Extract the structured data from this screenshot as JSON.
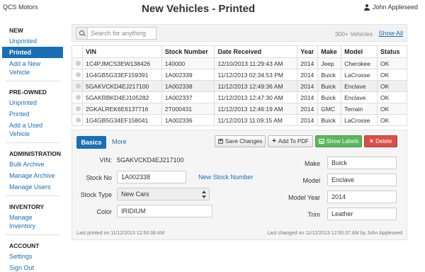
{
  "app": {
    "brand": "QCS Motors",
    "title": "New Vehicles - Printed",
    "user": "John Appleseed"
  },
  "sidebar": {
    "sections": [
      {
        "heading": "NEW",
        "items": [
          "Unprinted",
          "Printed",
          "Add a New Vehicle"
        ]
      },
      {
        "heading": "PRE-OWNED",
        "items": [
          "Unprinted",
          "Printed",
          "Add a Used Vehicle"
        ]
      },
      {
        "heading": "ADMINISTRATION",
        "items": [
          "Bulk Archive",
          "Manage Archive",
          "Manage Users"
        ]
      },
      {
        "heading": "INVENTORY",
        "items": [
          "Manage Inventory"
        ]
      },
      {
        "heading": "ACCOUNT",
        "items": [
          "Settings",
          "Sign Out"
        ]
      }
    ],
    "active": "Printed"
  },
  "search": {
    "placeholder": "Search for anything",
    "value": "",
    "count": "300+ Vehicles",
    "show_all": "Show All"
  },
  "table": {
    "headers": [
      "",
      "VIN",
      "Stock Number",
      "Date Received",
      "Year",
      "Make",
      "Model",
      "Status"
    ],
    "rows": [
      [
        "1C4PJMCS3EW138426",
        "140000",
        "12/10/2013 11:29:43 AM",
        "2014",
        "Jeep",
        "Cherokee",
        "OK"
      ],
      [
        "1G4GB5G33EF159391",
        "1A002339",
        "11/12/2013 02:34:53 PM",
        "2014",
        "Buick",
        "LaCrosse",
        "OK"
      ],
      [
        "5GAKVCKD4EJ217100",
        "1A002338",
        "11/12/2013 12:49:36 AM",
        "2014",
        "Buick",
        "Enclave",
        "OK"
      ],
      [
        "5GAKRBKD4EJ105282",
        "1A002337",
        "11/12/2013 12:47:30 AM",
        "2014",
        "Buick",
        "Enclave",
        "OK"
      ],
      [
        "2GKALREK6E6137716",
        "2T000431",
        "11/12/2013 12:46:19 AM",
        "2014",
        "GMC",
        "Terrain",
        "OK"
      ],
      [
        "1G4GB5G34EF158041",
        "1A002336",
        "11/12/2013 11:09:15 AM",
        "2014",
        "Buick",
        "LaCrosse",
        "OK"
      ]
    ]
  },
  "detail": {
    "tabs": {
      "basics": "Basics",
      "more": "More"
    },
    "buttons": {
      "save": "Save Changes",
      "pdf": "Add To PDF",
      "labels": "Show Labels",
      "delete": "Delete"
    },
    "vin_label": "VIN:",
    "vin": "5GAKVCKD4EJ217100",
    "stock_label": "Stock No",
    "stock": "1A002338",
    "new_stock_link": "New Stock Number",
    "stock_type_label": "Stock Type",
    "stock_type": "New Cars",
    "color_label": "Color",
    "color": "IRIDIUM",
    "make_label": "Make",
    "make": "Buick",
    "model_label": "Model",
    "model": "Enclave",
    "model_year_label": "Model Year",
    "model_year": "2014",
    "trim_label": "Trim",
    "trim": "Leather",
    "last_printed": "Last printed on 11/12/2013 12:50:38 AM",
    "last_changed": "Last changed on 11/12/2013 12:50:37 AM by John Appleseed"
  },
  "colors": {
    "accent": "#1a6fb4",
    "success": "#5bb75b",
    "danger": "#da4f49"
  },
  "icons": {
    "user": "user-icon",
    "search": "search-icon",
    "save": "floppy-icon",
    "pdf": "plus-icon",
    "labels": "labels-icon",
    "delete": "x-icon",
    "select": "select-arrows-icon"
  }
}
